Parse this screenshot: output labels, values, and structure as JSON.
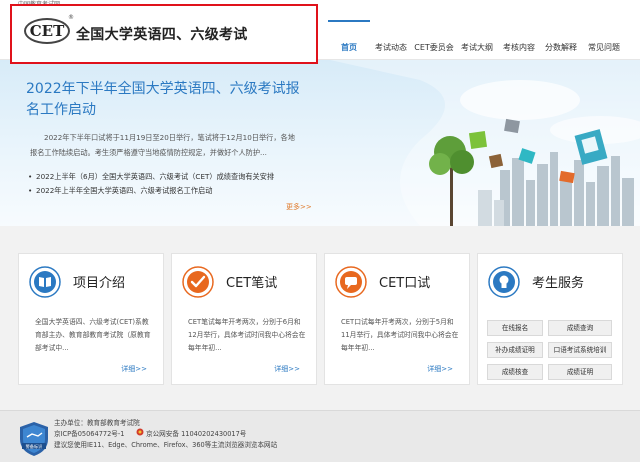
{
  "top_strip": {
    "text": "中国教育考试网"
  },
  "header": {
    "logo_mark": "CET",
    "logo_reg": "®",
    "site_title": "全国大学英语四、六级考试"
  },
  "nav": {
    "items": [
      {
        "label": "首页",
        "active": true
      },
      {
        "label": "考试动态",
        "active": false
      },
      {
        "label": "CET委员会",
        "active": false
      },
      {
        "label": "考试大纲",
        "active": false
      },
      {
        "label": "考核内容",
        "active": false
      },
      {
        "label": "分数解释",
        "active": false
      },
      {
        "label": "常见问题",
        "active": false
      }
    ]
  },
  "hero": {
    "title": "2022年下半年全国大学英语四、六级考试报名工作启动",
    "description": "2022年下半年口试将于11月19日至20日举行，笔试将于12月10日举行，各地报名工作陆续启动。考生须严格遵守当地疫情防控规定，并做好个人防护...",
    "news": [
      "2022上半年（6月）全国大学英语四、六级考试（CET）成绩查询有关安排",
      "2022年上半年全国大学英语四、六级考试报名工作启动"
    ],
    "more_label": "更多>>"
  },
  "cards": [
    {
      "title": "项目介绍",
      "icon": "book-icon",
      "desc": "全国大学英语四、六级考试(CET)系教育部主办、教育部教育考试院（原教育部考试中...",
      "more": "详细>>"
    },
    {
      "title": "CET笔试",
      "icon": "checkmark-icon",
      "desc": "CET笔试每年开考两次，分别于6月和12月举行，具体考试时间我中心将会在每年年初...",
      "more": "详细>>"
    },
    {
      "title": "CET口试",
      "icon": "speech-icon",
      "desc": "CET口试每年开考两次，分别于5月和11月举行，具体考试时间我中心将会在每年年初...",
      "more": "详细>>"
    },
    {
      "title": "考生服务",
      "icon": "lightbulb-icon",
      "buttons": [
        "在线报名",
        "成绩查询",
        "补办成绩证明",
        "口语考试系统培训",
        "成绩核查",
        "成绩证明"
      ]
    }
  ],
  "footer": {
    "host": "主办单位：教育部教育考试院",
    "icp": "京ICP备05064772号-1",
    "police": "京公网安备 11040202430017号",
    "browser": "建议您使用IE11、Edge、Chrome、Firefox、360等主流浏览器浏览本网站",
    "badge_text": "警备标识"
  },
  "colors": {
    "accent_blue": "#2b79c2",
    "accent_orange": "#e8681f",
    "highlight_red": "#e0121b"
  }
}
